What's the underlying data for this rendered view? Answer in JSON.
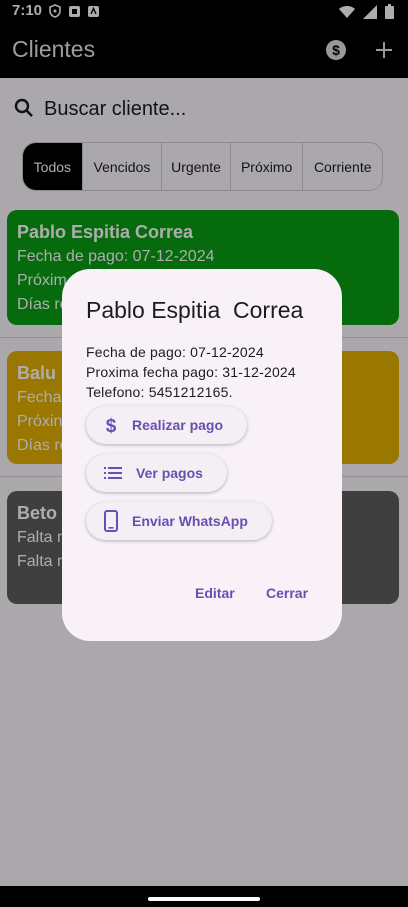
{
  "status_bar": {
    "time": "7:10"
  },
  "app_bar": {
    "title": "Clientes"
  },
  "search": {
    "placeholder": "Buscar cliente..."
  },
  "filters": [
    "Todos",
    "Vencidos",
    "Urgente",
    "Próximo",
    "Corriente"
  ],
  "cards": [
    {
      "title": "Pablo Espitia  Correa",
      "lines": [
        "Fecha de pago: 07-12-2024",
        "Próxim",
        "Días re"
      ],
      "color": "#0a9e12"
    },
    {
      "title": "Balu I",
      "lines": [
        "Fecha",
        "Próxin",
        "Días re"
      ],
      "color": "#e2b000"
    },
    {
      "title": "Beto C",
      "lines": [
        "Falta n",
        "Falta n"
      ],
      "color": "#5e5e5e"
    }
  ],
  "dialog": {
    "title": "Pablo Espitia  Correa",
    "fecha_pago": "Fecha de pago: 07-12-2024",
    "proxima_fecha": "Proxima fecha pago: 31-12-2024",
    "telefono": "Telefono: 5451212165.",
    "btn_pago": "Realizar pago",
    "btn_ver_pagos": "Ver pagos",
    "btn_whatsapp": "Enviar WhatsApp",
    "editar": "Editar",
    "cerrar": "Cerrar"
  },
  "colors": {
    "accent": "#6a4fb0",
    "dialog_bg": "#f8f1f8"
  }
}
